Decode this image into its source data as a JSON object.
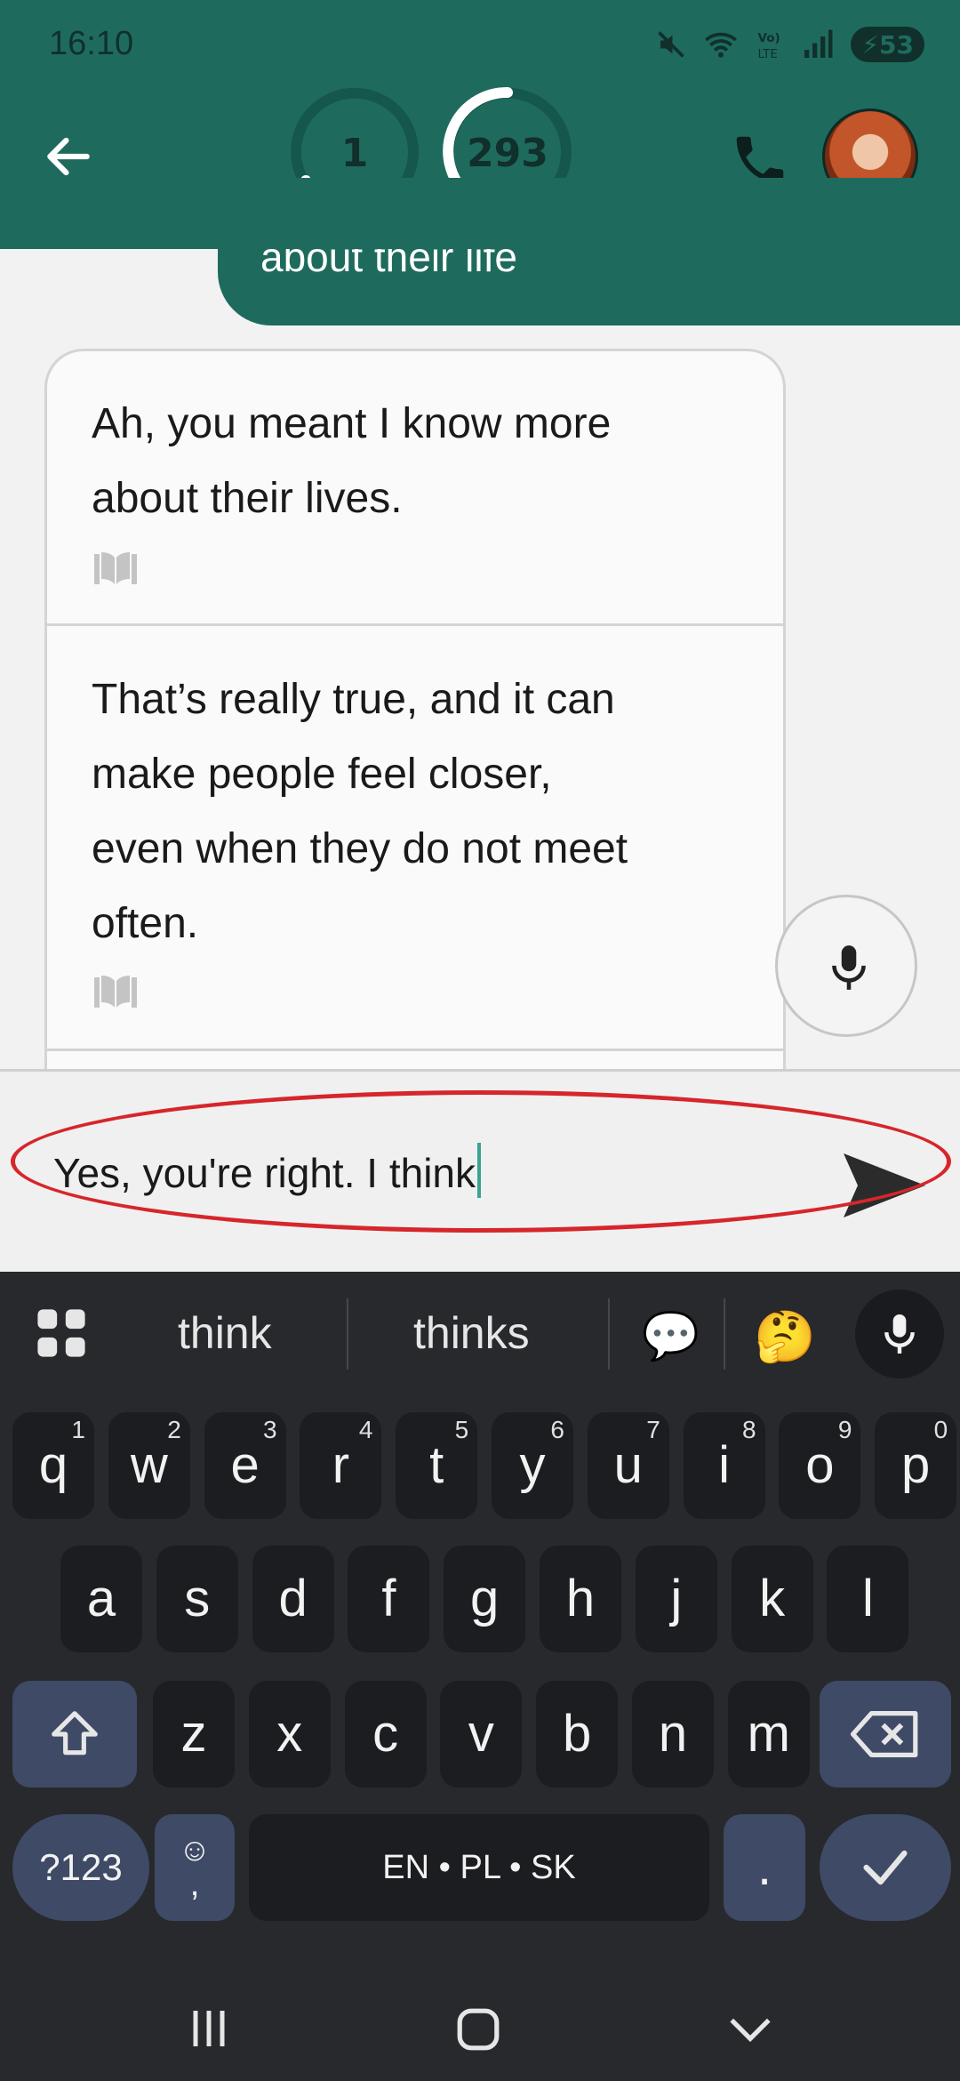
{
  "status_bar": {
    "time": "16:10",
    "battery": "53",
    "icons": [
      "mute-icon",
      "wifi-icon",
      "volte-icon",
      "signal-icon",
      "battery-icon"
    ]
  },
  "header": {
    "trophy_value": "1",
    "listeners_value": "293",
    "icons": [
      "back-arrow-icon",
      "trophy-icon",
      "listeners-icon",
      "phone-icon"
    ]
  },
  "chat": {
    "user_message_fragment": "about their life",
    "bot_messages": [
      {
        "lines": [
          "Ah, you meant I know more",
          "about their lives."
        ]
      },
      {
        "lines": [
          "That’s really true, and it can",
          "make people feel closer,",
          "even when they do not meet",
          "often."
        ]
      }
    ]
  },
  "input": {
    "value": "Yes, you're right. I think"
  },
  "keyboard": {
    "suggestions": [
      "think",
      "thinks"
    ],
    "row1": [
      {
        "k": "q",
        "n": "1"
      },
      {
        "k": "w",
        "n": "2"
      },
      {
        "k": "e",
        "n": "3"
      },
      {
        "k": "r",
        "n": "4"
      },
      {
        "k": "t",
        "n": "5"
      },
      {
        "k": "y",
        "n": "6"
      },
      {
        "k": "u",
        "n": "7"
      },
      {
        "k": "i",
        "n": "8"
      },
      {
        "k": "o",
        "n": "9"
      },
      {
        "k": "p",
        "n": "0"
      }
    ],
    "row2": [
      "a",
      "s",
      "d",
      "f",
      "g",
      "h",
      "j",
      "k",
      "l"
    ],
    "row3": [
      "z",
      "x",
      "c",
      "v",
      "b",
      "n",
      "m"
    ],
    "symbols_label": "?123",
    "comma_label": ",",
    "space_label": "EN • PL • SK",
    "period_label": "."
  },
  "colors": {
    "header": "#1e6b5e",
    "keyboard_bg": "#27292d",
    "key_bg": "#1c1d20",
    "mod_key_bg": "#3e4a66",
    "highlight": "#d6262b"
  }
}
